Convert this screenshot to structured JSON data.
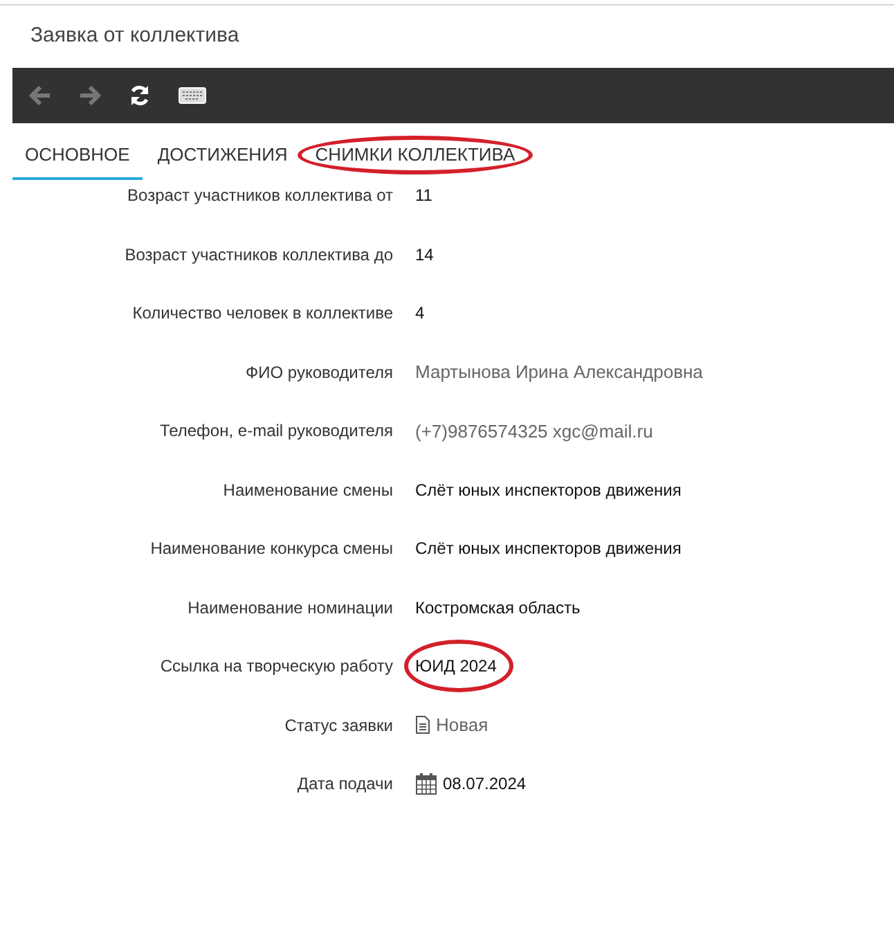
{
  "window": {
    "title": "Заявка от коллектива"
  },
  "tabs": [
    {
      "label": "ОСНОВНОЕ",
      "selected": true,
      "circled": false
    },
    {
      "label": "ДОСТИЖЕНИЯ",
      "selected": false,
      "circled": false
    },
    {
      "label": "СНИМКИ КОЛЛЕКТИВА",
      "selected": false,
      "circled": true
    }
  ],
  "fields": [
    {
      "label": "Возраст участников коллектива от",
      "value": "11",
      "kind": "text",
      "circled": false
    },
    {
      "label": "Возраст участников коллектива до",
      "value": "14",
      "kind": "text",
      "circled": false
    },
    {
      "label": "Количество человек в коллективе",
      "value": "4",
      "kind": "text",
      "circled": false
    },
    {
      "label": "ФИО руководителя",
      "value": "Мартынова Ирина Александровна",
      "kind": "muted",
      "circled": false
    },
    {
      "label": "Телефон, e-mail руководителя",
      "value": "(+7)9876574325 xgc@mail.ru",
      "kind": "muted",
      "circled": false
    },
    {
      "label": "Наименование смены",
      "value": "Слёт юных инспекторов движения",
      "kind": "text",
      "circled": false
    },
    {
      "label": "Наименование конкурса смены",
      "value": "Слёт юных инспекторов движения",
      "kind": "text",
      "circled": false
    },
    {
      "label": "Наименование номинации",
      "value": "Костромская область",
      "kind": "text",
      "circled": false
    },
    {
      "label": "Ссылка на творческую работу",
      "value": "ЮИД 2024",
      "kind": "text",
      "circled": true
    },
    {
      "label": "Статус заявки",
      "value": "Новая",
      "kind": "status",
      "circled": false
    },
    {
      "label": "Дата подачи",
      "value": "08.07.2024",
      "kind": "date",
      "circled": false
    }
  ]
}
